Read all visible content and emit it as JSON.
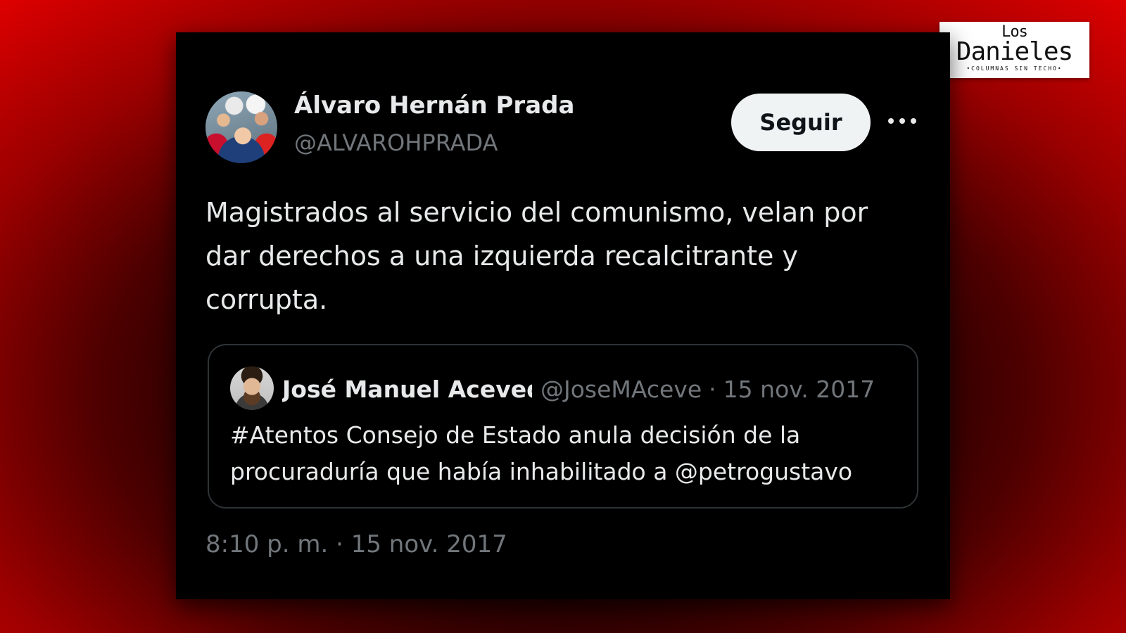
{
  "logo": {
    "line1": "Los",
    "line2": "Danieles",
    "tagline": "•COLUMNAS SIN TECHO•"
  },
  "tweet": {
    "author_name": "Álvaro Hernán Prada",
    "author_handle": "@ALVAROHPRADA",
    "follow_label": "Seguir",
    "text": "Magistrados al servicio del comunismo, velan por dar derechos a una izquierda recalcitrante y corrupta.",
    "timestamp": "8:10 p. m. · 15 nov. 2017",
    "quoted": {
      "author_name": "José Manuel Acevedo",
      "author_handle": "@JoseMAceve",
      "separator": "·",
      "date": "15 nov. 2017",
      "text": "#Atentos Consejo de Estado anula decisión de la procuraduría que había inhabilitado a @petrogustavo"
    }
  },
  "colors": {
    "background_outer": "#e10000",
    "card": "#000000",
    "text_primary": "#e7e9ea",
    "text_secondary": "#71767b",
    "follow_button": "#eff3f4"
  },
  "icons": {
    "more": "more-horizontal-icon"
  }
}
